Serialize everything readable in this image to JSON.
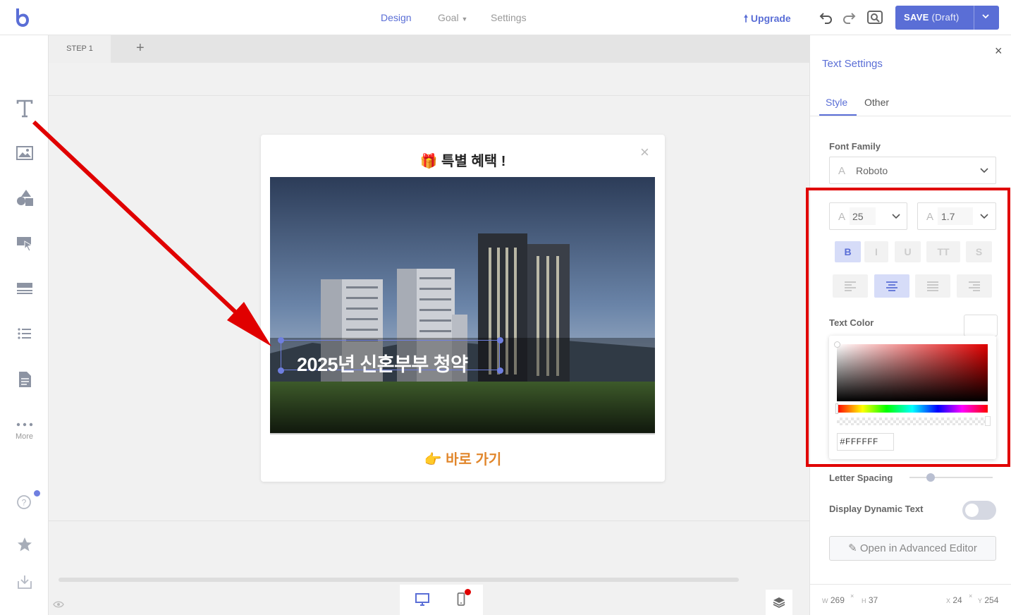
{
  "topbar": {
    "tabs": [
      {
        "label": "Design",
        "active": true
      },
      {
        "label": "Goal",
        "active": false
      },
      {
        "label": "Settings",
        "active": false
      }
    ],
    "upgrade_label": "Upgrade",
    "save_label": "SAVE",
    "save_status": "(Draft)",
    "icons": [
      "undo-icon",
      "redo-icon",
      "preview-icon",
      "chevron-down-icon"
    ]
  },
  "left_toolbar": {
    "items": [
      "text-icon",
      "image-icon",
      "shapes-icon",
      "button-icon",
      "form-icon",
      "list-icon",
      "document-icon",
      "more-icon",
      "help-icon",
      "star-icon",
      "download-icon"
    ],
    "more_label": "More"
  },
  "steps": {
    "tabs": [
      {
        "label": "STEP 1"
      }
    ],
    "add_label": "+"
  },
  "popup": {
    "title": "특별 혜택 !",
    "title_emoji": "🎁",
    "close": "×",
    "overlay_text": "2025년 신혼부부 청약",
    "cta_text": "바로 가기",
    "cta_emoji": "👉"
  },
  "right_panel": {
    "title": "Text Settings",
    "close": "×",
    "tabs": [
      {
        "label": "Style",
        "active": true
      },
      {
        "label": "Other",
        "active": false
      }
    ],
    "font_family_label": "Font Family",
    "font_family": "Roboto",
    "font_size": "25",
    "line_height": "1.7",
    "style_buttons": [
      {
        "label": "B",
        "on": true
      },
      {
        "label": "I",
        "on": false
      },
      {
        "label": "U",
        "on": false
      },
      {
        "label": "TT",
        "on": false
      },
      {
        "label": "S",
        "on": false
      }
    ],
    "align_buttons": [
      {
        "name": "align-left-icon",
        "on": false
      },
      {
        "name": "align-center-icon",
        "on": true
      },
      {
        "name": "align-justify-icon",
        "on": false
      },
      {
        "name": "align-right-icon",
        "on": false
      }
    ],
    "text_color_label": "Text Color",
    "text_color_value": "#FFFFFF",
    "letter_spacing_label": "Letter Spacing",
    "letter_spacing_level": 0.25,
    "display_dynamic_label": "Display Dynamic Text",
    "display_dynamic_on": false,
    "advanced_editor_label": "Open in Advanced Editor",
    "dimensions": {
      "w_label": "W",
      "w": "269",
      "h_label": "H",
      "h": "37",
      "x_label": "X",
      "x": "24",
      "y_label": "Y",
      "y": "254"
    }
  },
  "colors": {
    "accent": "#5a6ed6",
    "annotation_red": "#e00000",
    "cta_orange": "#e1862b"
  }
}
